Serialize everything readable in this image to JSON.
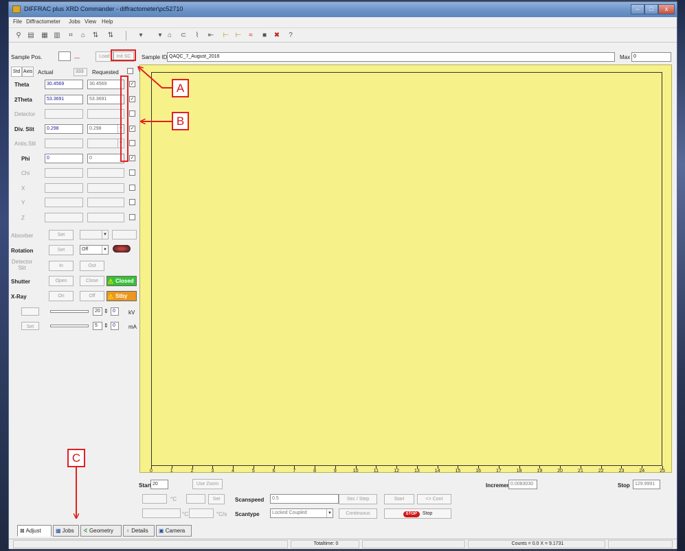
{
  "window": {
    "title": "DIFFRAC plus XRD Commander - diffractometer\\pc52710",
    "controls": {
      "minimize": "‒",
      "maximize": "□",
      "close": "x"
    }
  },
  "menu": [
    "File",
    "Diffractometer",
    "Jobs",
    "View",
    "Help"
  ],
  "toolbar": {
    "icons": [
      "pointer-icon",
      "panel-icon",
      "grid-icon",
      "chart-icon",
      "align-icon",
      "lock-icon",
      "scan-icon",
      "scan2-icon",
      "dropdown-icon",
      "lock2-icon",
      "link-icon",
      "measure-icon",
      "home-icon",
      "axis-icon",
      "axis2-icon",
      "xray-icon",
      "stop-icon",
      "tools-icon",
      "help-icon"
    ],
    "help_glyph": "?"
  },
  "sample": {
    "pos_label": "Sample Pos.",
    "load_label": "Load",
    "init_sc_label": "Init SC",
    "id_label": "Sample ID",
    "id_value": "QAQC_7_August_2016",
    "max_label": "Max",
    "max_value": "0"
  },
  "tabs_small": {
    "std": "Std",
    "axis": "Axis"
  },
  "columns": {
    "actual": "Actual",
    "requested": "Requested",
    "disabled_value": "333"
  },
  "axes": [
    {
      "name": "Theta",
      "actual": "30.4569",
      "requested": "30.4569",
      "checked": true,
      "active": true
    },
    {
      "name": "2Theta",
      "actual": "53.3691",
      "requested": "53.3691",
      "checked": true,
      "active": true
    },
    {
      "name": "Detector",
      "actual": "",
      "requested": "",
      "checked": false,
      "active": false
    },
    {
      "name": "Div. Slit",
      "actual": "0.298",
      "requested": "0.298",
      "checked": true,
      "active": true
    },
    {
      "name": "Antis.Slit",
      "actual": "",
      "requested": "",
      "checked": false,
      "active": false
    },
    {
      "name": "Phi",
      "actual": "0",
      "requested": "0",
      "checked": true,
      "active": true
    },
    {
      "name": "Chi",
      "actual": "",
      "requested": "",
      "checked": false,
      "active": false
    },
    {
      "name": "X",
      "actual": "",
      "requested": "",
      "checked": false,
      "active": false
    },
    {
      "name": "Y",
      "actual": "",
      "requested": "",
      "checked": false,
      "active": false
    },
    {
      "name": "Z",
      "actual": "",
      "requested": "",
      "checked": false,
      "active": false
    }
  ],
  "controls": {
    "absorber_label": "Absorber",
    "set": "Set",
    "rotation_label": "Rotation",
    "rotation_value": "Off",
    "detector_slit_label": "Detector Slit",
    "in": "In",
    "out": "Out",
    "shutter_label": "Shutter",
    "open": "Open",
    "close": "Close",
    "shutter_state": "Closed",
    "xray_label": "X-Ray",
    "on": "On",
    "off": "Off",
    "xray_state": "Stby",
    "kv_value": "20",
    "kv_readout": "0",
    "kv_unit": "kV",
    "ma_value": "5",
    "ma_readout": "0",
    "ma_unit": "mA",
    "set2": "Set"
  },
  "scan": {
    "start_label": "Start",
    "start_value": "20",
    "use_zoom": "Use Zoom",
    "increment_label": "Increment",
    "increment_value": "0.0083030",
    "stop_label": "Stop",
    "stop_value": "129.9991",
    "scanspeed_label": "Scanspeed",
    "scanspeed_value": "0.5",
    "sec_step": "Sec / Step",
    "start_btn": "Start",
    "cont_btn": "<> Cont",
    "set_btn": "Set",
    "deg_c": "°C",
    "deg_cs": "°C/s",
    "scantype_label": "Scantype",
    "scantype_value": "Locked Coupled",
    "continuous": "Continuous",
    "stop_btn": "Stop",
    "stop_icon_text": "STOP"
  },
  "tabs": [
    "Adjust",
    "Jobs",
    "Geometry",
    "Details",
    "Camera"
  ],
  "status": {
    "totaltime": "Totaltime: 0",
    "counts": "Counts = 0.0    X = 9.1731"
  },
  "chart_data": {
    "type": "line",
    "x": [
      0,
      1,
      2,
      3,
      4,
      5,
      6,
      7,
      8,
      9,
      10,
      11,
      12,
      13,
      14,
      15,
      16,
      17,
      18,
      19,
      20,
      21,
      22,
      23,
      24,
      25
    ],
    "series": [],
    "xlabel": "",
    "ylabel": "",
    "background": "#f7f18a",
    "grid": false
  },
  "annotations": {
    "a": "A",
    "b": "B",
    "c": "C",
    "color": "#e02020"
  }
}
